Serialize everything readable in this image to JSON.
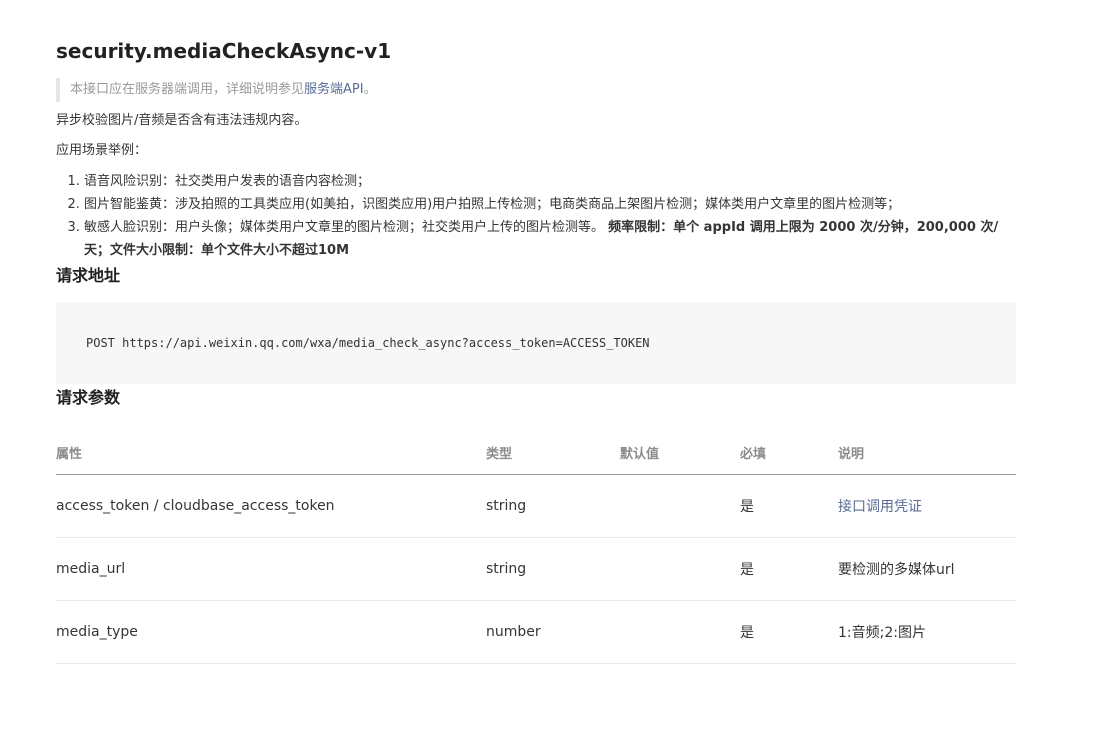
{
  "page": {
    "title": "security.mediaCheckAsync-v1",
    "note_prefix": "本接口应在服务器端调用，详细说明参见",
    "note_link": "服务端API",
    "note_suffix": "。",
    "intro": "异步校验图片/音频是否含有违法违规内容。",
    "scenarios_label": "应用场景举例：",
    "scenarios": [
      "语音风险识别：社交类用户发表的语音内容检测；",
      "图片智能鉴黄：涉及拍照的工具类应用(如美拍，识图类应用)用户拍照上传检测；电商类商品上架图片检测；媒体类用户文章里的图片检测等；",
      "敏感人脸识别：用户头像；媒体类用户文章里的图片检测；社交类用户上传的图片检测等。"
    ],
    "limits_text": "频率限制：单个 appId 调用上限为 2000 次/分钟，200,000 次/天；文件大小限制：单个文件大小不超过10M"
  },
  "request": {
    "heading": "请求地址",
    "code": "POST https://api.weixin.qq.com/wxa/media_check_async?access_token=ACCESS_TOKEN"
  },
  "params": {
    "heading": "请求参数",
    "columns": [
      "属性",
      "类型",
      "默认值",
      "必填",
      "说明"
    ],
    "rows": [
      {
        "name": "access_token / cloudbase_access_token",
        "type": "string",
        "default": "",
        "required": "是",
        "desc": "接口调用凭证",
        "desc_is_link": true
      },
      {
        "name": "media_url",
        "type": "string",
        "default": "",
        "required": "是",
        "desc": "要检测的多媒体url",
        "desc_is_link": false
      },
      {
        "name": "media_type",
        "type": "number",
        "default": "",
        "required": "是",
        "desc": "1:音频;2:图片",
        "desc_is_link": false
      }
    ]
  },
  "colors": {
    "link": "#576b95",
    "code_bg": "#f7f7f7",
    "note_border": "#e6e6e6"
  }
}
